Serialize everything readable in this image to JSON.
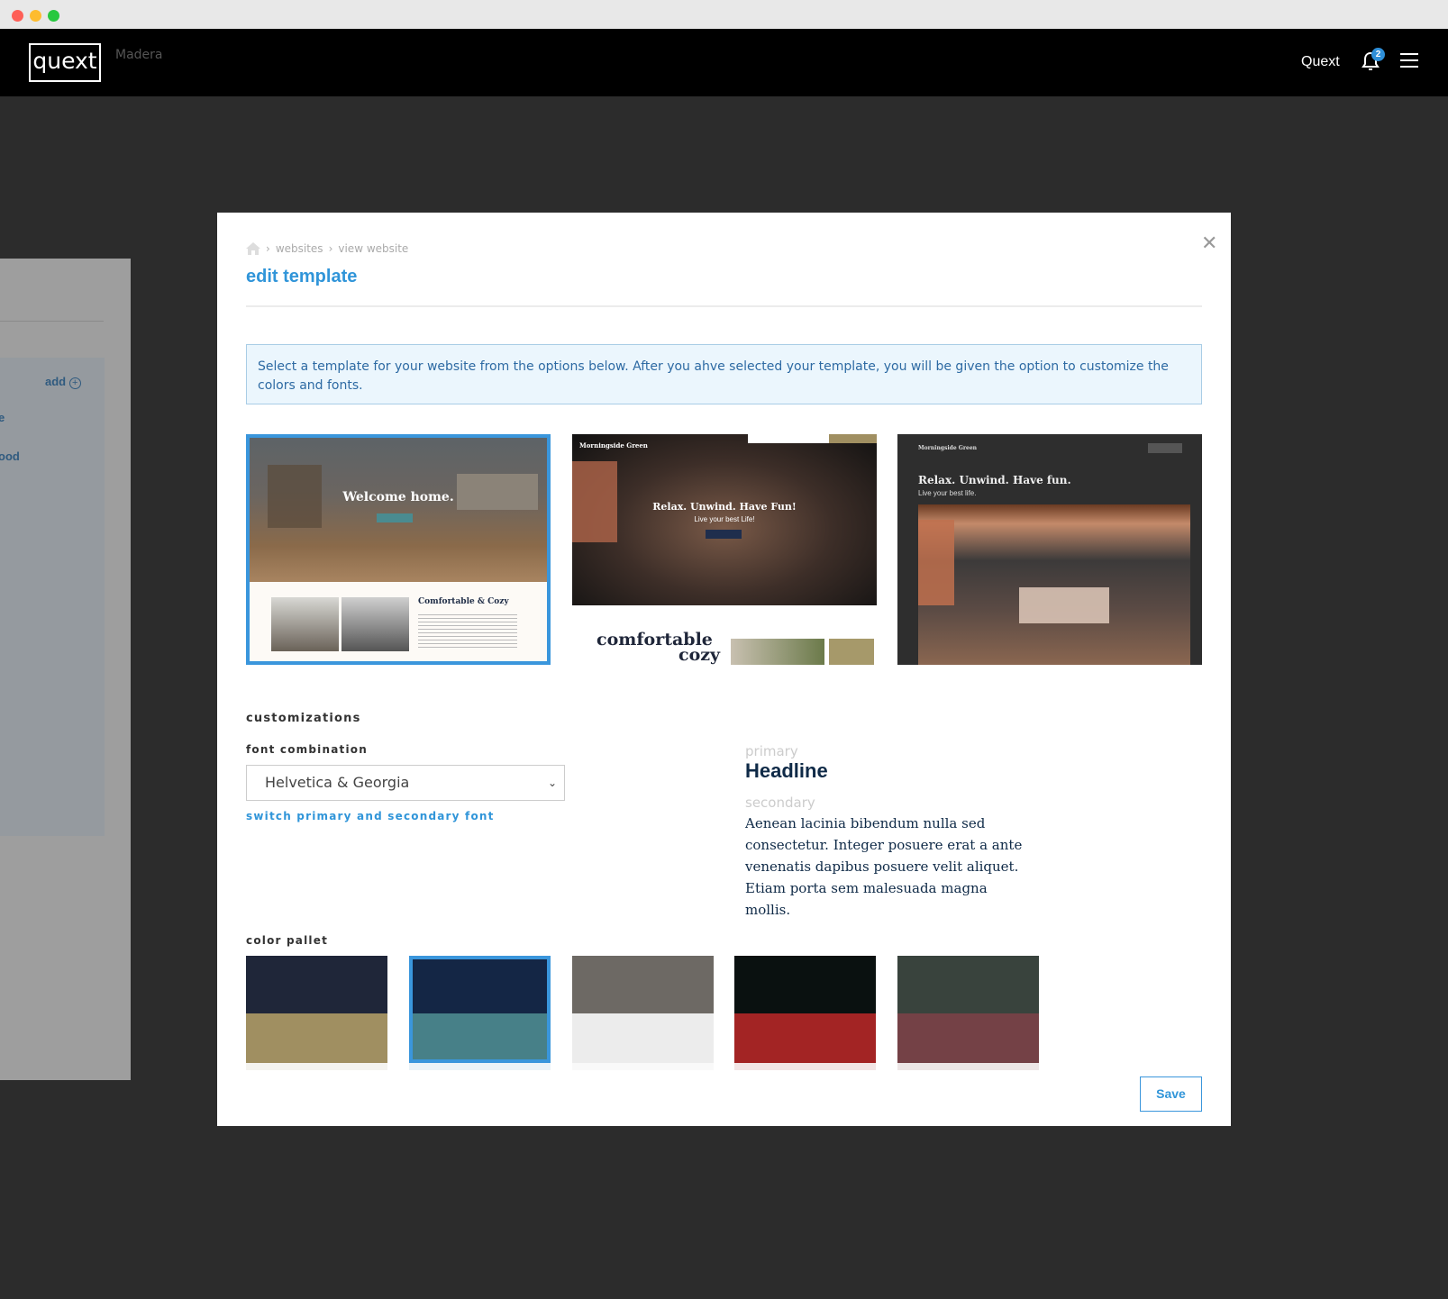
{
  "header": {
    "logo": "quext",
    "org": "Madera",
    "user": "Quext",
    "notification_count": "2"
  },
  "background": {
    "add_label": "add",
    "item1": "e",
    "item2": "ood"
  },
  "modal": {
    "breadcrumb": [
      "websites",
      "view website"
    ],
    "title": "edit template",
    "info": "Select a template for your website from the options below. After you ahve selected your template, you will be given the option to customize the colors and fonts.",
    "templates": [
      {
        "headline": "Welcome home.",
        "section": "Comfortable & Cozy",
        "selected": true
      },
      {
        "brand": "Morningside Green",
        "headline": "Relax. Unwind. Have Fun!",
        "sub": "Live your best Life!",
        "section1": "comfortable",
        "section2": "cozy",
        "selected": false
      },
      {
        "brand": "Morningside Green",
        "headline": "Relax. Unwind. Have fun.",
        "sub": "Live your best life.",
        "selected": false
      }
    ],
    "customizations_label": "customizations",
    "font_label": "font combination",
    "font_value": "Helvetica & Georgia",
    "switch_link": "switch primary and secondary font",
    "preview": {
      "primary_label": "primary",
      "headline": "Headline",
      "secondary_label": "secondary",
      "body": "Aenean lacinia bibendum nulla sed consectetur. Integer posuere erat a ante venenatis dapibus posuere velit aliquet. Etiam porta sem malesuada magna mollis."
    },
    "palette_label": "color pallet",
    "palettes": [
      {
        "primary": "#1f2639",
        "secondary": "#a08f61",
        "selected": false
      },
      {
        "primary": "#142645",
        "secondary": "#478088",
        "selected": true
      },
      {
        "primary": "#6d6964",
        "secondary": "#ececec",
        "selected": false
      },
      {
        "primary": "#0a1110",
        "secondary": "#a32424",
        "selected": false
      },
      {
        "primary": "#39433d",
        "secondary": "#744146",
        "selected": false
      }
    ],
    "save_label": "Save"
  },
  "colors": {
    "accent": "#3095d9"
  }
}
